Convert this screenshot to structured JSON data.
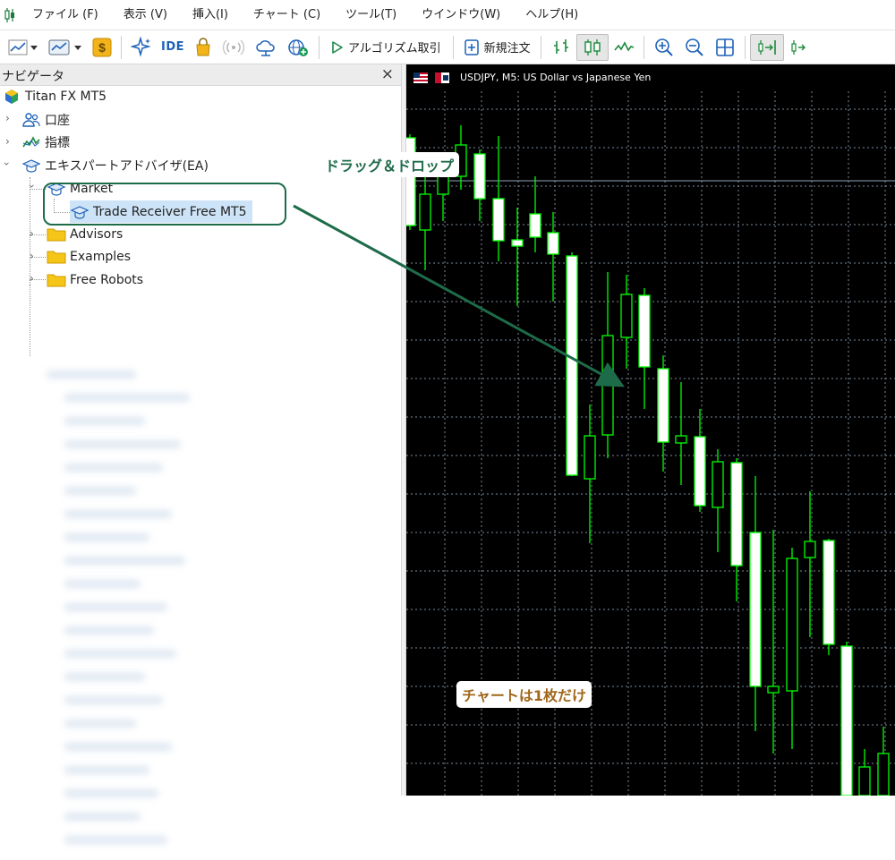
{
  "menu": {
    "items": [
      "ファイル (F)",
      "表示 (V)",
      "挿入(I)",
      "チャート (C)",
      "ツール(T)",
      "ウインドウ(W)",
      "ヘルプ(H)"
    ]
  },
  "toolbar": {
    "ide_label": "IDE",
    "algo_label": "アルゴリズム取引",
    "new_order_label": "新規注文"
  },
  "navigator": {
    "title": "ナビゲータ",
    "close": "×",
    "root": "Titan FX MT5",
    "items": {
      "account": "口座",
      "indicators": "指標",
      "expert_advisors": "エキスパートアドバイザ(EA)",
      "market": "Market",
      "trade_receiver": "Trade Receiver Free MT5",
      "advisors": "Advisors",
      "examples": "Examples",
      "free_robots": "Free Robots"
    }
  },
  "chart": {
    "title": "USDJPY, M5:  US Dollar vs Japanese Yen",
    "colors": {
      "background": "#000000",
      "bull": "#000000",
      "bear": "#ffffff",
      "wick": "#00ff00",
      "grid": "#7a8a9a",
      "price_line": "#8fa3b8"
    }
  },
  "annotations": {
    "drag_drop": "ドラッグ＆ドロップ",
    "one_chart": "チャートは1枚だけ"
  },
  "colors": {
    "accent_green": "#1e6b4a",
    "note_brown": "#a0671a",
    "selection": "#cde3f7"
  }
}
